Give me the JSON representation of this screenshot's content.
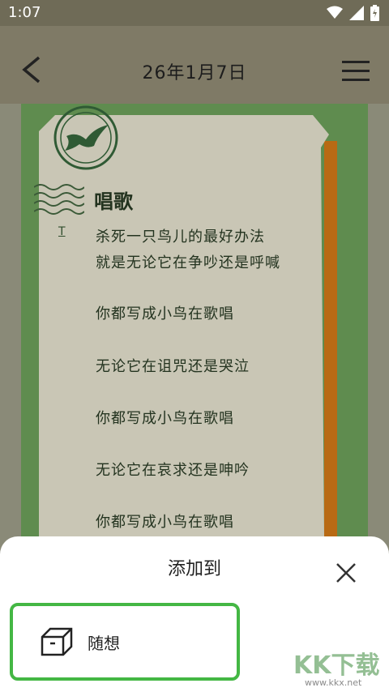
{
  "status_bar": {
    "time": "1:07"
  },
  "header": {
    "title": "26年1月7日"
  },
  "poem": {
    "title": "唱歌",
    "marker": "T",
    "lines": [
      "杀死一只鸟儿的最好办法",
      "就是无论它在争吵还是呼喊",
      "你都写成小鸟在歌唱",
      "无论它在诅咒还是哭泣",
      "你都写成小鸟在歌唱",
      "无论它在哀求还是呻吟",
      "你都写成小鸟在歌唱"
    ]
  },
  "sheet": {
    "title": "添加到",
    "option_label": "随想"
  },
  "watermark": {
    "logo": "KK下载",
    "url": "www.kkx.net"
  },
  "colors": {
    "header_bg": "#7f7a66",
    "green_panel": "#5f8c4f",
    "option_border": "#44b744"
  },
  "icons": [
    "wifi-icon",
    "signal-icon",
    "battery-icon",
    "back-icon",
    "menu-icon",
    "close-icon",
    "box-icon",
    "stamp-icon"
  ]
}
